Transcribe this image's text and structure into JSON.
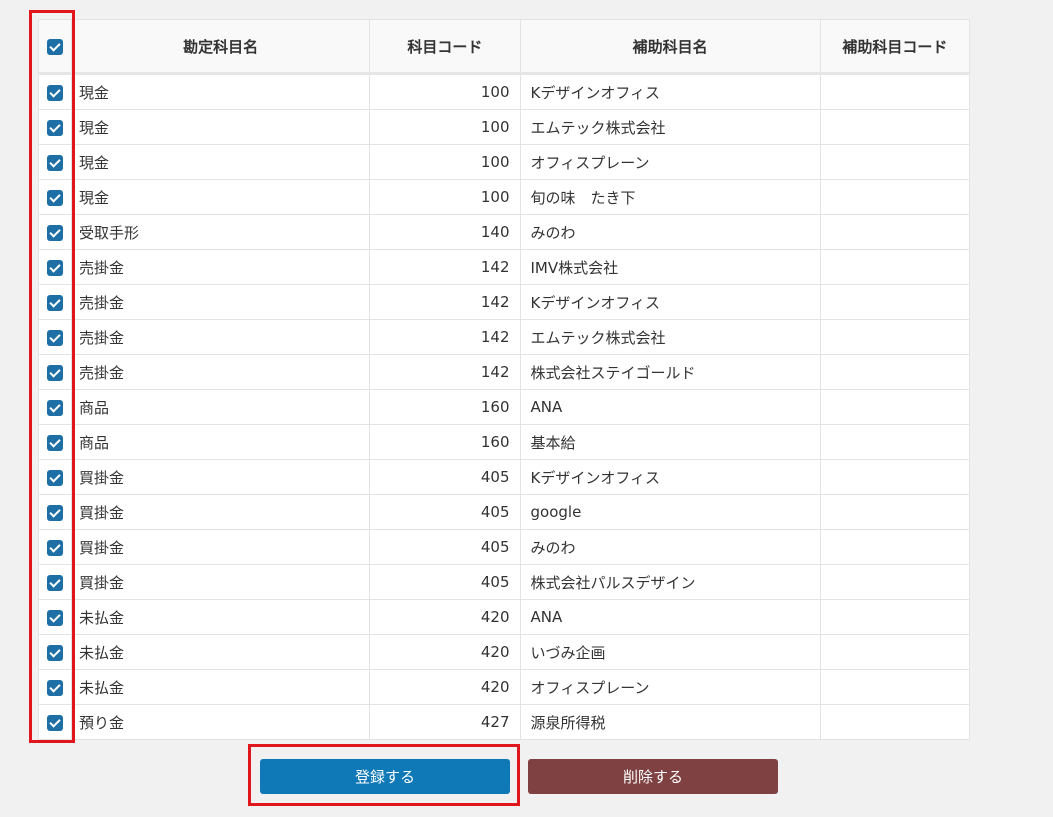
{
  "table": {
    "headers": {
      "account_name": "勘定科目名",
      "account_code": "科目コード",
      "sub_account_name": "補助科目名",
      "sub_account_code": "補助科目コード"
    },
    "rows": [
      {
        "account": "現金",
        "code": "100",
        "sub": "Kデザインオフィス",
        "subcode": ""
      },
      {
        "account": "現金",
        "code": "100",
        "sub": "エムテック株式会社",
        "subcode": ""
      },
      {
        "account": "現金",
        "code": "100",
        "sub": "オフィスプレーン",
        "subcode": ""
      },
      {
        "account": "現金",
        "code": "100",
        "sub": "旬の味　たき下",
        "subcode": ""
      },
      {
        "account": "受取手形",
        "code": "140",
        "sub": "みのわ",
        "subcode": ""
      },
      {
        "account": "売掛金",
        "code": "142",
        "sub": "IMV株式会社",
        "subcode": ""
      },
      {
        "account": "売掛金",
        "code": "142",
        "sub": "Kデザインオフィス",
        "subcode": ""
      },
      {
        "account": "売掛金",
        "code": "142",
        "sub": "エムテック株式会社",
        "subcode": ""
      },
      {
        "account": "売掛金",
        "code": "142",
        "sub": "株式会社ステイゴールド",
        "subcode": ""
      },
      {
        "account": "商品",
        "code": "160",
        "sub": "ANA",
        "subcode": ""
      },
      {
        "account": "商品",
        "code": "160",
        "sub": "基本給",
        "subcode": ""
      },
      {
        "account": "買掛金",
        "code": "405",
        "sub": "Kデザインオフィス",
        "subcode": ""
      },
      {
        "account": "買掛金",
        "code": "405",
        "sub": "google",
        "subcode": ""
      },
      {
        "account": "買掛金",
        "code": "405",
        "sub": "みのわ",
        "subcode": ""
      },
      {
        "account": "買掛金",
        "code": "405",
        "sub": "株式会社パルスデザイン",
        "subcode": ""
      },
      {
        "account": "未払金",
        "code": "420",
        "sub": "ANA",
        "subcode": ""
      },
      {
        "account": "未払金",
        "code": "420",
        "sub": "いづみ企画",
        "subcode": ""
      },
      {
        "account": "未払金",
        "code": "420",
        "sub": "オフィスプレーン",
        "subcode": ""
      },
      {
        "account": "預り金",
        "code": "427",
        "sub": "源泉所得税",
        "subcode": ""
      }
    ]
  },
  "buttons": {
    "register": "登録する",
    "delete": "削除する"
  },
  "colors": {
    "checkbox": "#1d6fa5",
    "register_button": "#0f78b7",
    "delete_button": "#7f4141",
    "highlight": "#e0161c"
  },
  "select_all_checked": true
}
